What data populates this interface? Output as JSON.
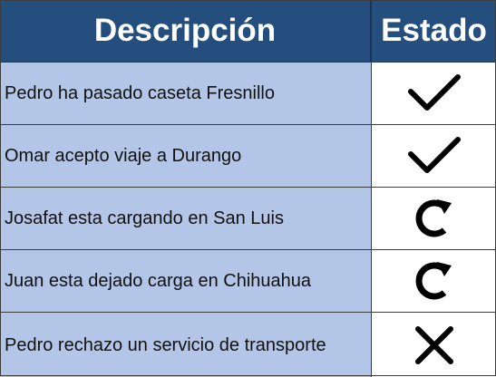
{
  "header": {
    "description": "Descripción",
    "status": "Estado"
  },
  "rows": [
    {
      "description": "Pedro ha pasado caseta Fresnillo",
      "status_icon": "check-icon"
    },
    {
      "description": "Omar acepto viaje a Durango",
      "status_icon": "check-icon"
    },
    {
      "description": "Josafat esta cargando en San Luis",
      "status_icon": "refresh-icon"
    },
    {
      "description": "Juan esta dejado carga en Chihuahua",
      "status_icon": "refresh-icon"
    },
    {
      "description": "Pedro rechazo un servicio de transporte",
      "status_icon": "x-icon"
    }
  ],
  "colors": {
    "header_bg": "#234e7d",
    "description_bg": "#b4c6e7",
    "status_bg": "#ffffff"
  }
}
